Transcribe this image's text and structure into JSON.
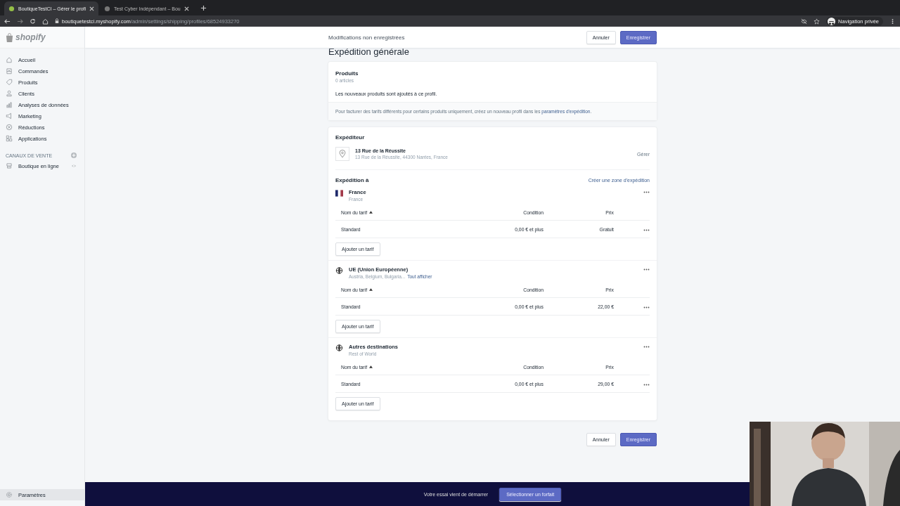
{
  "browser": {
    "tabs": [
      {
        "title": "BoutiqueTestCI – Gérer le profi",
        "selected": true
      },
      {
        "title": "Test Cyber Indépendant – Bou",
        "selected": false
      }
    ],
    "url_host": "boutiquetestci.myshopify.com",
    "url_path": "/admin/settings/shipping/profiles/68524933270",
    "profile_label": "Navigation privée"
  },
  "topbar": {
    "message": "Modifications non enregistrées",
    "cancel": "Annuler",
    "save": "Enregistrer"
  },
  "sidebar": {
    "logo_text": "shopify",
    "items": [
      {
        "label": "Accueil",
        "selected": false
      },
      {
        "label": "Commandes",
        "selected": false
      },
      {
        "label": "Produits",
        "selected": false
      },
      {
        "label": "Clients",
        "selected": false
      },
      {
        "label": "Analyses de données",
        "selected": false
      },
      {
        "label": "Marketing",
        "selected": false
      },
      {
        "label": "Réductions",
        "selected": false
      },
      {
        "label": "Applications",
        "selected": false
      }
    ],
    "section_title": "CANAUX DE VENTE",
    "channels": [
      {
        "label": "Boutique en ligne"
      }
    ],
    "settings": {
      "label": "Paramètres",
      "selected": true
    }
  },
  "page": {
    "title": "Expédition générale",
    "products": {
      "title": "Produits",
      "count": "0 articles",
      "text": "Les nouveaux produits sont ajoutés à ce profil.",
      "note": "Pour facturer des tarifs différents pour certains produits uniquement, créez un nouveau profil dans les ",
      "note_link": "paramètres d'expédition",
      "note_end": "."
    },
    "shipper": {
      "title": "Expéditeur",
      "name": "13 Rue de la Réussite",
      "address": "13 Rue de la Réussite, 44300 Nantes, France",
      "action": "Gérer"
    },
    "zones_title": "Expédition à",
    "create_zone": "Créer une zone d'expédition",
    "zones": [
      {
        "kind": "flag",
        "name": "France",
        "subtitle": "France",
        "columns": [
          "Nom du tarif",
          "Condition",
          "Prix"
        ],
        "rows": [
          {
            "name": "Standard",
            "condition": "0,00 € et plus",
            "price": "Gratuit"
          }
        ],
        "add": "Ajouter un tarif"
      },
      {
        "kind": "globe",
        "name": "UE (Union Européenne)",
        "subtitle": "Austria, Belgium, Bulgaria...",
        "link": "Tout afficher",
        "columns": [
          "Nom du tarif",
          "Condition",
          "Prix"
        ],
        "rows": [
          {
            "name": "Standard",
            "condition": "0,00 € et plus",
            "price": "22,00 €"
          }
        ],
        "add": "Ajouter un tarif"
      },
      {
        "kind": "globe",
        "name": "Autres destinations",
        "subtitle": "Rest of World",
        "columns": [
          "Nom du tarif",
          "Condition",
          "Prix"
        ],
        "rows": [
          {
            "name": "Standard",
            "condition": "0,00 € et plus",
            "price": "29,00 €"
          }
        ],
        "add": "Ajouter un tarif"
      }
    ]
  },
  "footer": {
    "cancel": "Annuler",
    "save": "Enregistrer"
  },
  "trial_bar": {
    "message": "Votre essai vient de démarrer",
    "button": "Sélectionner un forfait"
  }
}
